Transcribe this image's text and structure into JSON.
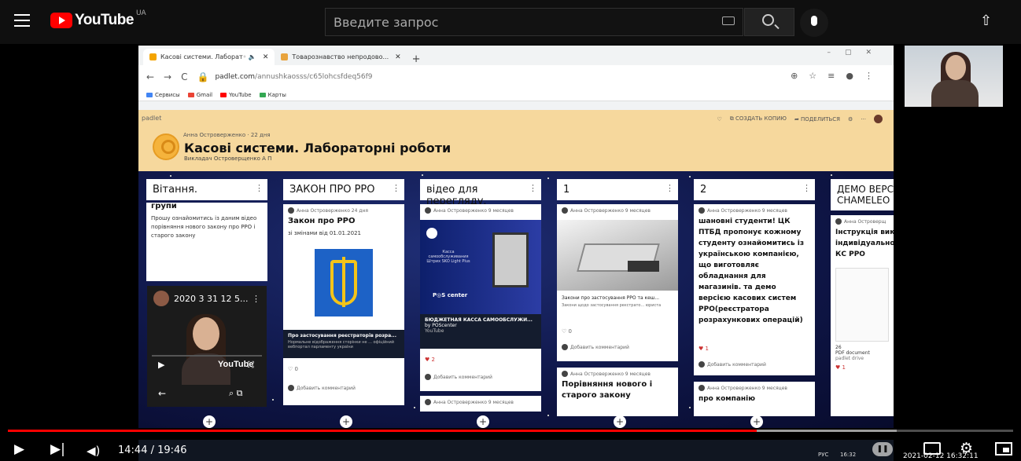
{
  "yt": {
    "logo_text": "YouTube",
    "country": "UA",
    "search_placeholder": "Введите запрос"
  },
  "browser": {
    "tabs": [
      {
        "label": "Касові системи. Лаборат◦ 🔈",
        "active": true,
        "color": "#f4a400"
      },
      {
        "label": "Товарознавство непродово...",
        "active": false,
        "color": "#e8a33c"
      }
    ],
    "url_main": "padlet.com",
    "url_rest": "/annushkaosss/c65lohcsfdeq56f9",
    "bookmarks": [
      {
        "label": "Сервисы",
        "color": "#4285f4"
      },
      {
        "label": "Gmail",
        "color": "#ea4335"
      },
      {
        "label": "YouTube",
        "color": "#ff0000"
      },
      {
        "label": "Карты",
        "color": "#34a853"
      }
    ]
  },
  "padlet": {
    "brand": "padlet",
    "author_line": "Анна Островерженко · 22 дня",
    "title": "Касові системи. Лабораторні роботи",
    "subtitle": "Викладач Островерщенко А П",
    "actions": [
      "♡",
      "⧉ СОЗДАТЬ КОПИЮ",
      "➦ ПОДЕЛИТЬСЯ",
      "⚙",
      "···"
    ],
    "columns": [
      {
        "title": "Вітання."
      },
      {
        "title": "ЗАКОН ПРО РРО"
      },
      {
        "title": "відео для перегляду."
      },
      {
        "title": "1"
      },
      {
        "title": "2"
      },
      {
        "title": "ДЕМО ВЕРС CHAMELEO"
      }
    ],
    "cards": {
      "c1_top": "групи",
      "c1_text": "Прошу ознайомитись із даним відео порівняння нового закону про РРО і старого закону",
      "c1_video_title": "2020 3 31 12 5...",
      "c1_video_brand": "YouTube",
      "c2_author": "Анна Островерженко 24 дня",
      "c2_title": "Закон про РРО",
      "c2_text": "зі змінами від 01.01.2021",
      "c2_caption": "Про застосування реєстраторів розра...",
      "c2_caption2": "Нормальне відображення сторінки не ... офіційний вебпортал парламенту україни",
      "c2_likes": "♡ 0",
      "c2_comment": "Добавить комментарий",
      "c3_author": "Анна Островерженко 9 месяцев",
      "c3_video_text": "Касса самообслуживания Штрих SKO Light Plus",
      "c3_pos": "P◎S center",
      "c3_caption": "БЮДЖЕТНАЯ КАССА САМООБСЛУЖИ...",
      "c3_by": "by POScenter",
      "c3_src": "YouTube",
      "c3_likes": "♥ 2",
      "c3_comment": "Добавить комментарий",
      "c3b_author": "Анна Островерженко 9 месяцев",
      "c4_author": "Анна Островерженко 9 месяцев",
      "c4_caption": "Закони про застосування РРО та кеш...",
      "c4_caption2": "Закони щодо застосування реєстрато... юриста",
      "c4_likes": "♡ 0",
      "c4_comment": "Добавить комментарий",
      "c4b_author": "Анна Островерженко 9 месяцев",
      "c4b_title": "Порівняння нового і старого закону",
      "c5_author": "Анна Островерженко 9 месяцев",
      "c5_text": "шановні студенти! ЦК ПТБД пропонує кожному студенту ознайомитись із українською компанією, що виготовляє обладнання для магазинів. та демо версією касових систем РРО(реєстратора розрахункових операцій)",
      "c5_likes": "♥ 1",
      "c5_comment": "Добавить комментарий",
      "c5b_author": "Анна Островерженко 9 месяцев",
      "c5b_title": "про компанію",
      "c6_author": "Анна Островерщ",
      "c6_title": "Інструкція вик індивідуально КС РРО",
      "c6_meta1": "26",
      "c6_meta2": "PDF document",
      "c6_meta3": "padlet drive",
      "c6_likes": "♥ 1"
    }
  },
  "player": {
    "time": "14:44 / 19:46",
    "progress_played": 0.745,
    "system_lang": "РУС",
    "system_time": "16:32",
    "stamp": "2021-02-12 16:32:11"
  }
}
